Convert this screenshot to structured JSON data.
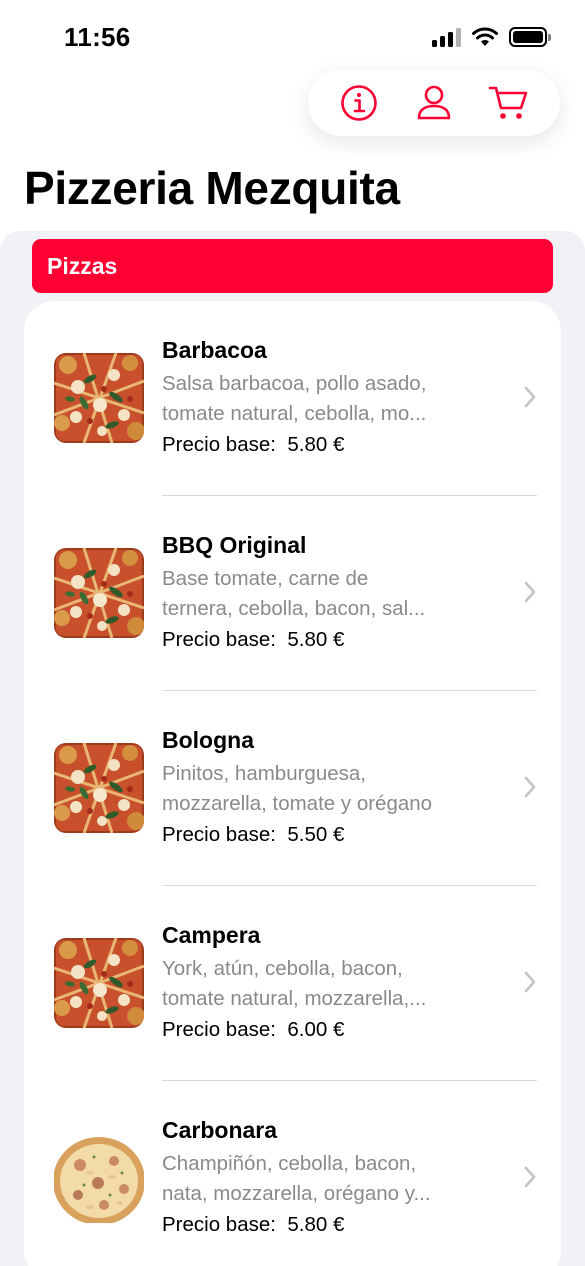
{
  "status_bar": {
    "time": "11:56"
  },
  "toolbar": {
    "accent_color": "#ff0033",
    "buttons": [
      {
        "icon": "info-icon"
      },
      {
        "icon": "person-icon"
      },
      {
        "icon": "cart-icon"
      }
    ]
  },
  "page_title": "Pizzeria Mezquita",
  "section": {
    "title": "Pizzas",
    "color": "#ff0033"
  },
  "items": [
    {
      "name": "Barbacoa",
      "desc_line1": "Salsa barbacoa, pollo asado,",
      "desc_line2": "tomate natural, cebolla, mo...",
      "price_label": "Precio base:",
      "price": "5.80 €",
      "image": "pizza-red-icon"
    },
    {
      "name": "BBQ Original",
      "desc_line1": "Base tomate, carne de",
      "desc_line2": "ternera, cebolla, bacon, sal...",
      "price_label": "Precio base:",
      "price": "5.80 €",
      "image": "pizza-red-icon"
    },
    {
      "name": "Bologna",
      "desc_line1": "Pinitos, hamburguesa,",
      "desc_line2": "mozzarella, tomate y orégano",
      "price_label": "Precio base:",
      "price": "5.50 €",
      "image": "pizza-red-icon"
    },
    {
      "name": "Campera",
      "desc_line1": "York, atún, cebolla, bacon,",
      "desc_line2": "tomate natural, mozzarella,...",
      "price_label": "Precio base:",
      "price": "6.00 €",
      "image": "pizza-red-icon"
    },
    {
      "name": "Carbonara",
      "desc_line1": "Champiñón, cebolla, bacon,",
      "desc_line2": "nata, mozzarella, orégano y...",
      "price_label": "Precio base:",
      "price": "5.80 €",
      "image": "pizza-white-icon"
    }
  ]
}
